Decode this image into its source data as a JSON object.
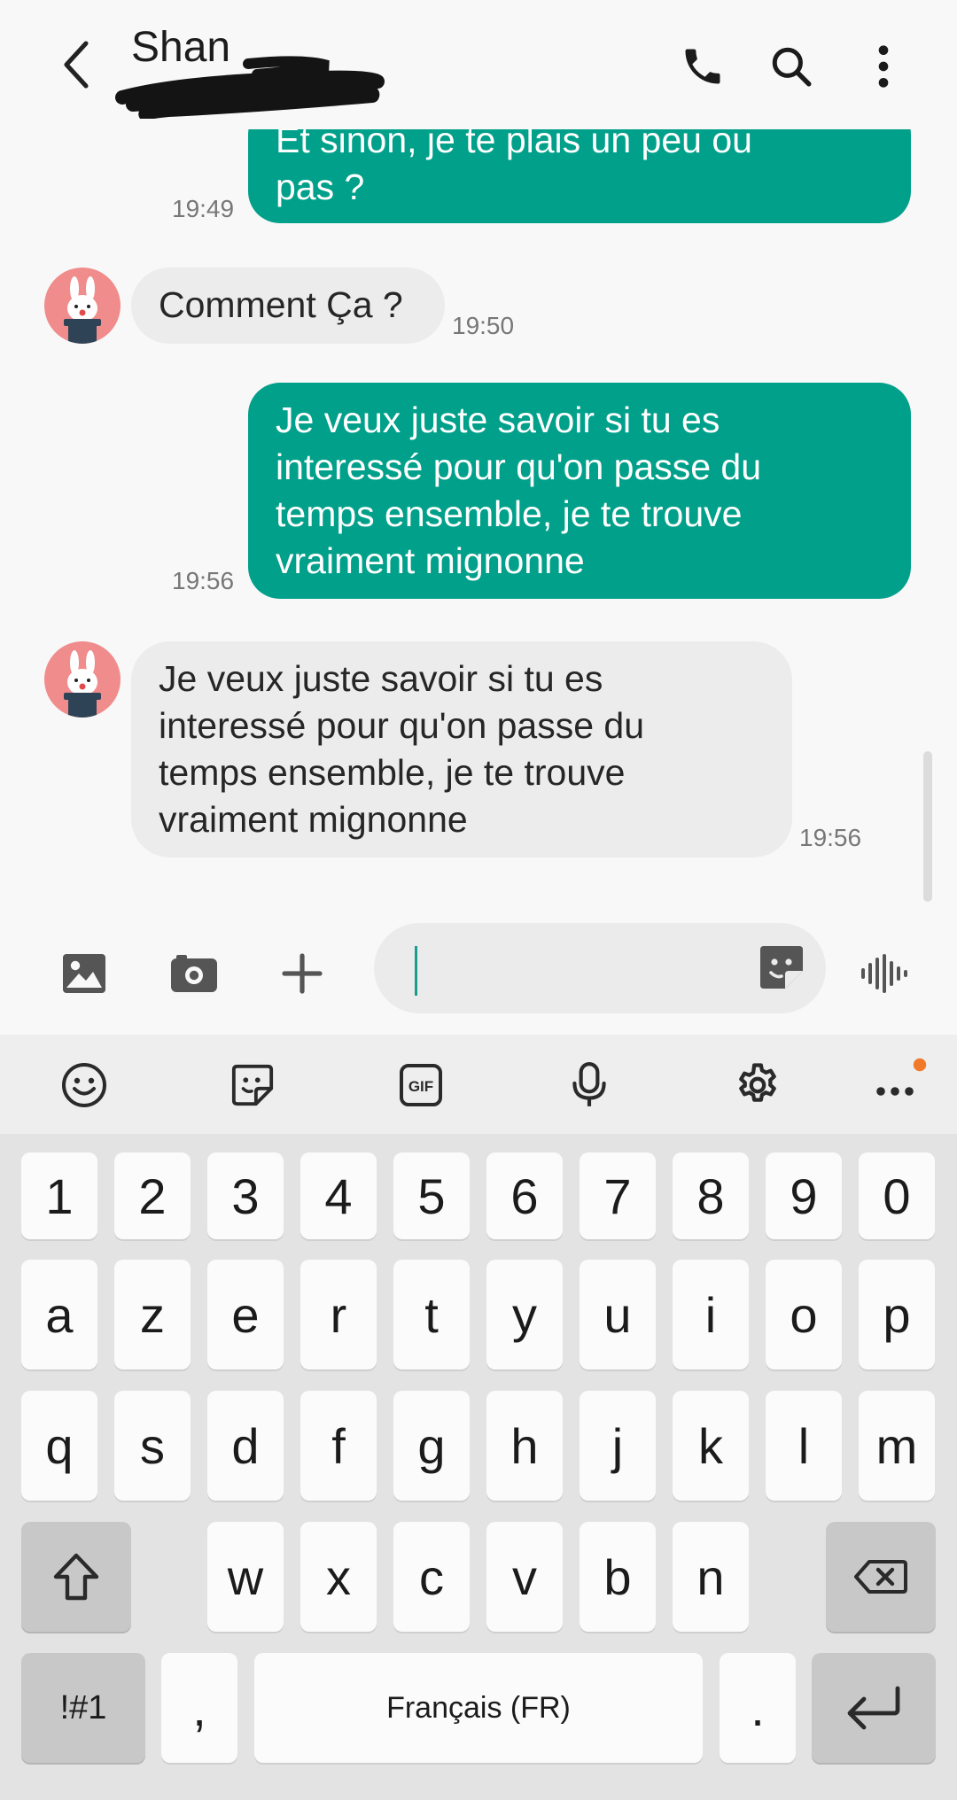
{
  "header": {
    "contact_name": "Shan",
    "icons": [
      "back-arrow-icon",
      "phone-icon",
      "search-icon",
      "more-vertical-icon"
    ]
  },
  "messages": [
    {
      "direction": "out",
      "text_lines": [
        "Et sinon, je te plais un peu ou",
        "pas ?"
      ],
      "time": "19:49"
    },
    {
      "direction": "in",
      "text_lines": [
        "Comment Ça ?"
      ],
      "time": "19:50"
    },
    {
      "direction": "out",
      "text_lines": [
        "Je veux juste savoir si tu es",
        "interessé pour qu'on passe du",
        "temps ensemble, je te trouve",
        "vraiment mignonne"
      ],
      "time": "19:56"
    },
    {
      "direction": "in",
      "text_lines": [
        "Je veux juste savoir si tu es",
        "interessé pour qu'on passe du",
        "temps ensemble, je te trouve",
        "vraiment mignonne"
      ],
      "time": "19:56"
    }
  ],
  "composer": {
    "icons": [
      "gallery-icon",
      "camera-icon",
      "plus-icon",
      "sticker-icon",
      "voice-icon"
    ],
    "input_value": ""
  },
  "keyboard_toolbar": {
    "icons": [
      "emoji-icon",
      "sticker-icon",
      "gif-icon",
      "microphone-icon",
      "settings-icon",
      "more-horizontal-icon"
    ],
    "gif_label": "GIF",
    "notification_dot_color": "#f07a2a"
  },
  "keyboard": {
    "row1": [
      "1",
      "2",
      "3",
      "4",
      "5",
      "6",
      "7",
      "8",
      "9",
      "0"
    ],
    "row2": [
      "a",
      "z",
      "e",
      "r",
      "t",
      "y",
      "u",
      "i",
      "o",
      "p"
    ],
    "row3": [
      "q",
      "s",
      "d",
      "f",
      "g",
      "h",
      "j",
      "k",
      "l",
      "m"
    ],
    "row4": [
      "w",
      "x",
      "c",
      "v",
      "b",
      "n"
    ],
    "symbols_label": "!#1",
    "comma_label": ",",
    "space_label": "Français (FR)",
    "period_label": "."
  },
  "colors": {
    "outgoing_bubble": "#00a08a",
    "incoming_bubble": "#ececec",
    "accent": "#1a9c8e"
  }
}
